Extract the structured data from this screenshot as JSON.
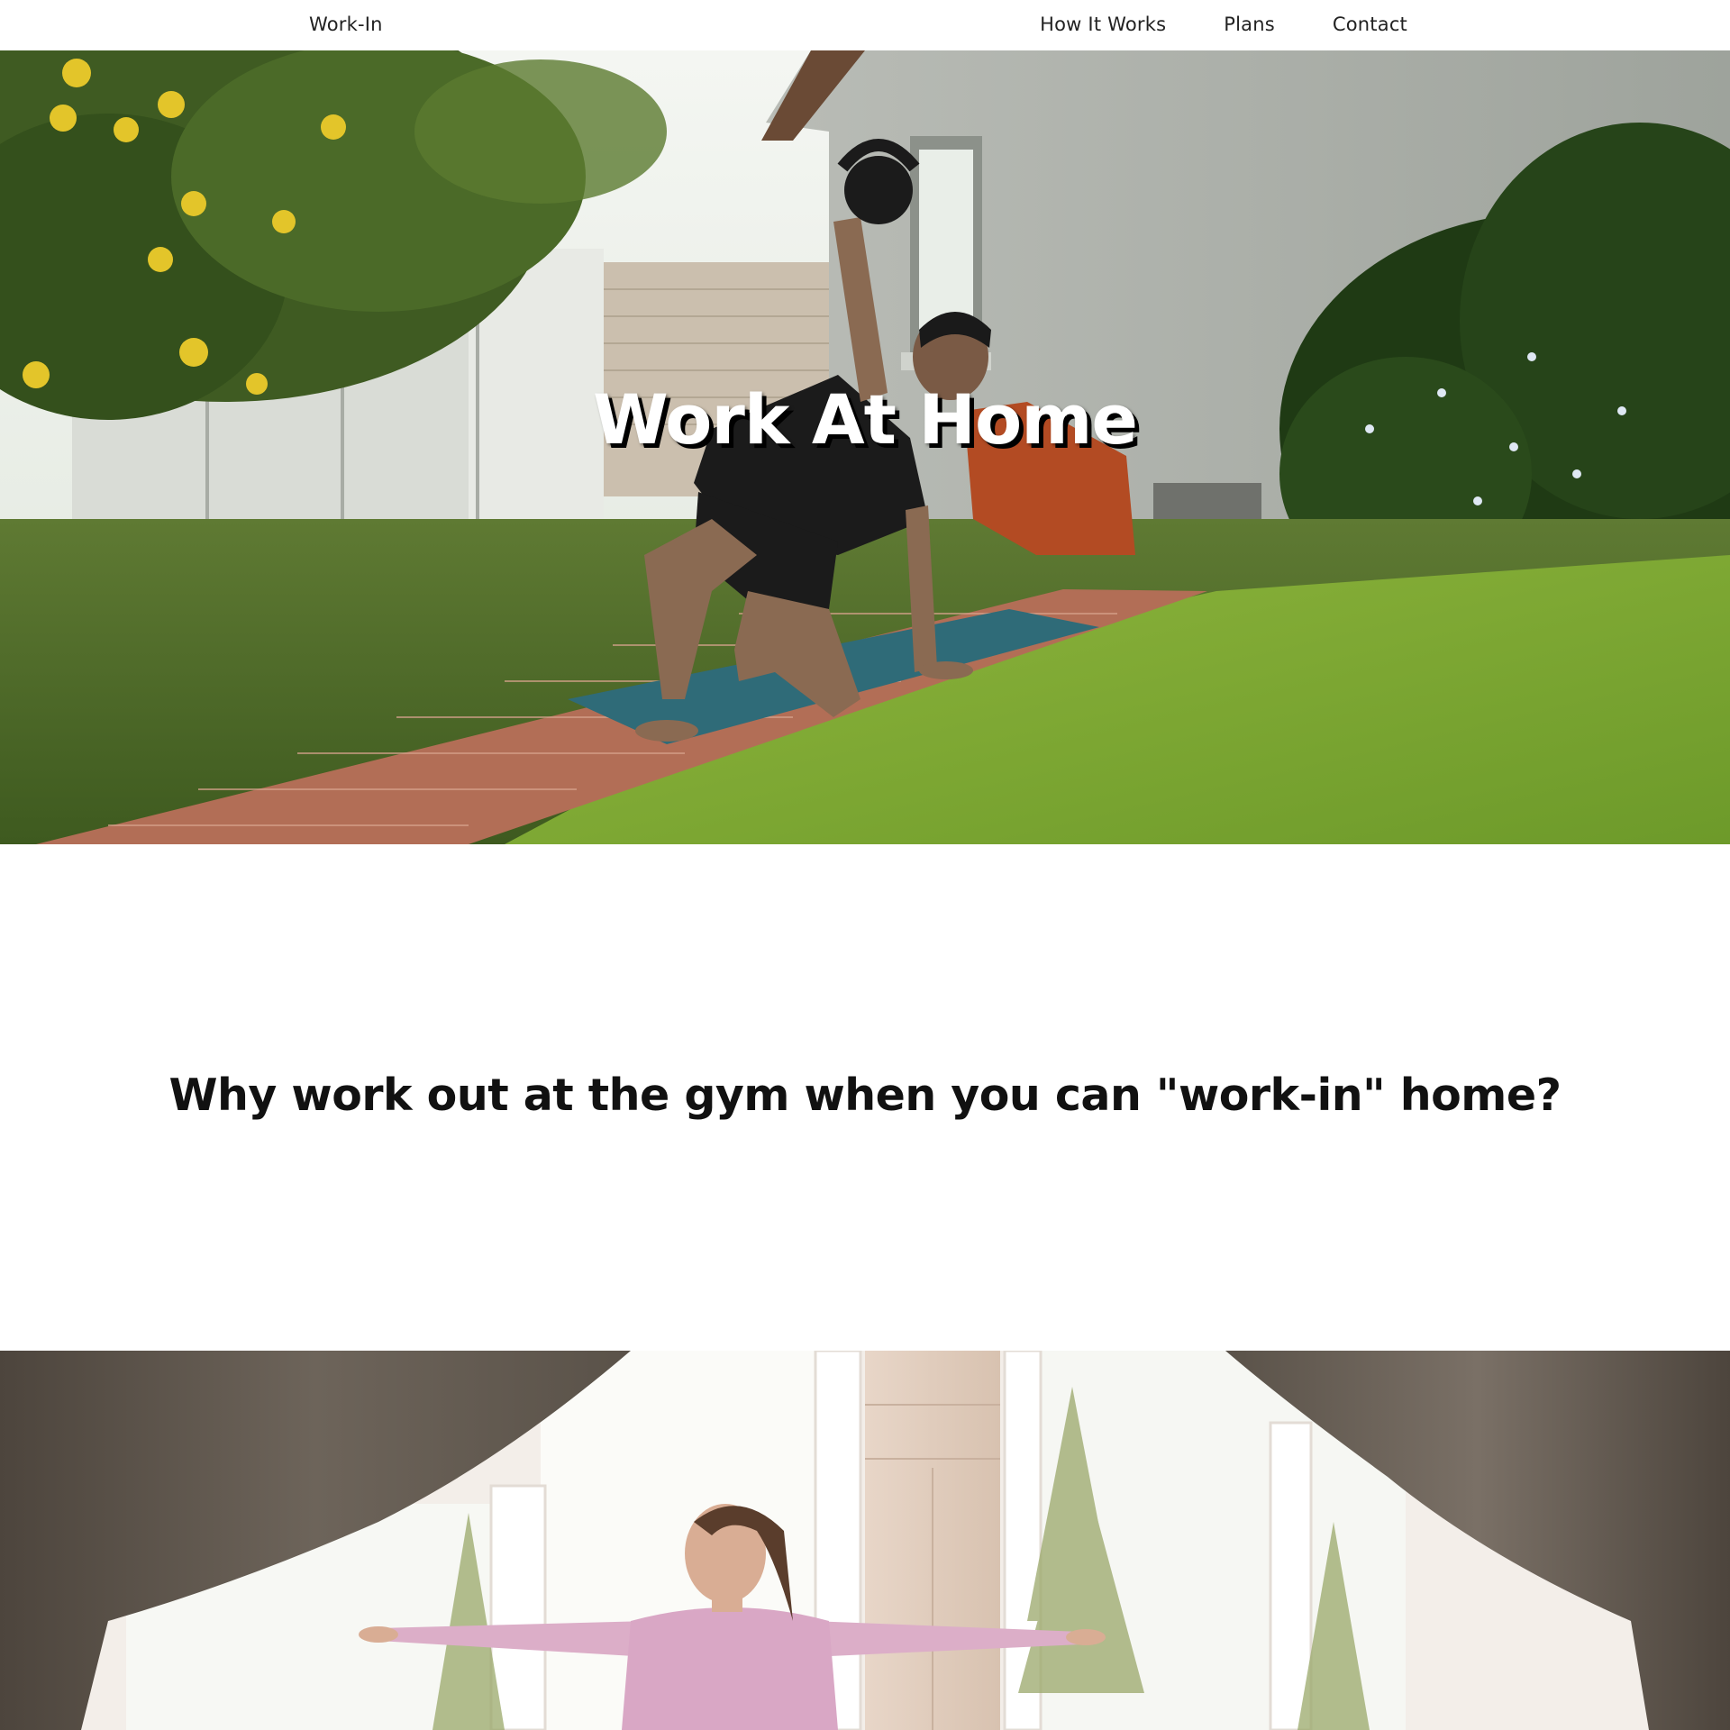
{
  "nav": {
    "brand": "Work-In",
    "links": [
      {
        "label": "How It Works"
      },
      {
        "label": "Plans"
      },
      {
        "label": "Contact"
      }
    ]
  },
  "hero": {
    "title": "Work At Home"
  },
  "intro": {
    "heading": "Why work out at the gym when you can \"work-in\" home?"
  },
  "colors": {
    "text": "#222222",
    "background": "#ffffff",
    "hero_title": "#ffffff"
  }
}
